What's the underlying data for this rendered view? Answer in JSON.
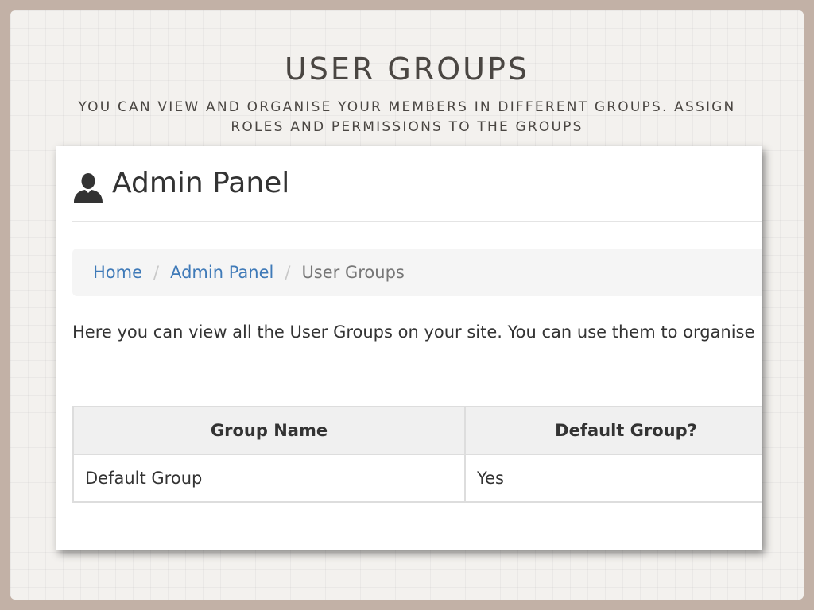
{
  "slide": {
    "title": "USER GROUPS",
    "subtitle": "YOU CAN VIEW AND ORGANISE YOUR MEMBERS IN DIFFERENT GROUPS. ASSIGN ROLES AND PERMISSIONS TO THE GROUPS"
  },
  "panel": {
    "title": "Admin Panel",
    "icon": "user-icon"
  },
  "breadcrumb": {
    "items": [
      "Home",
      "Admin Panel",
      "User Groups"
    ],
    "separator": "/"
  },
  "description": "Here you can view all the User Groups on your site. You can use them to organise",
  "table": {
    "headers": [
      "Group Name",
      "Default Group?"
    ],
    "rows": [
      [
        "Default Group",
        "Yes"
      ]
    ]
  },
  "colors": {
    "frame": "#c2b1a6",
    "link": "#3f7ab8",
    "text": "#333333"
  }
}
